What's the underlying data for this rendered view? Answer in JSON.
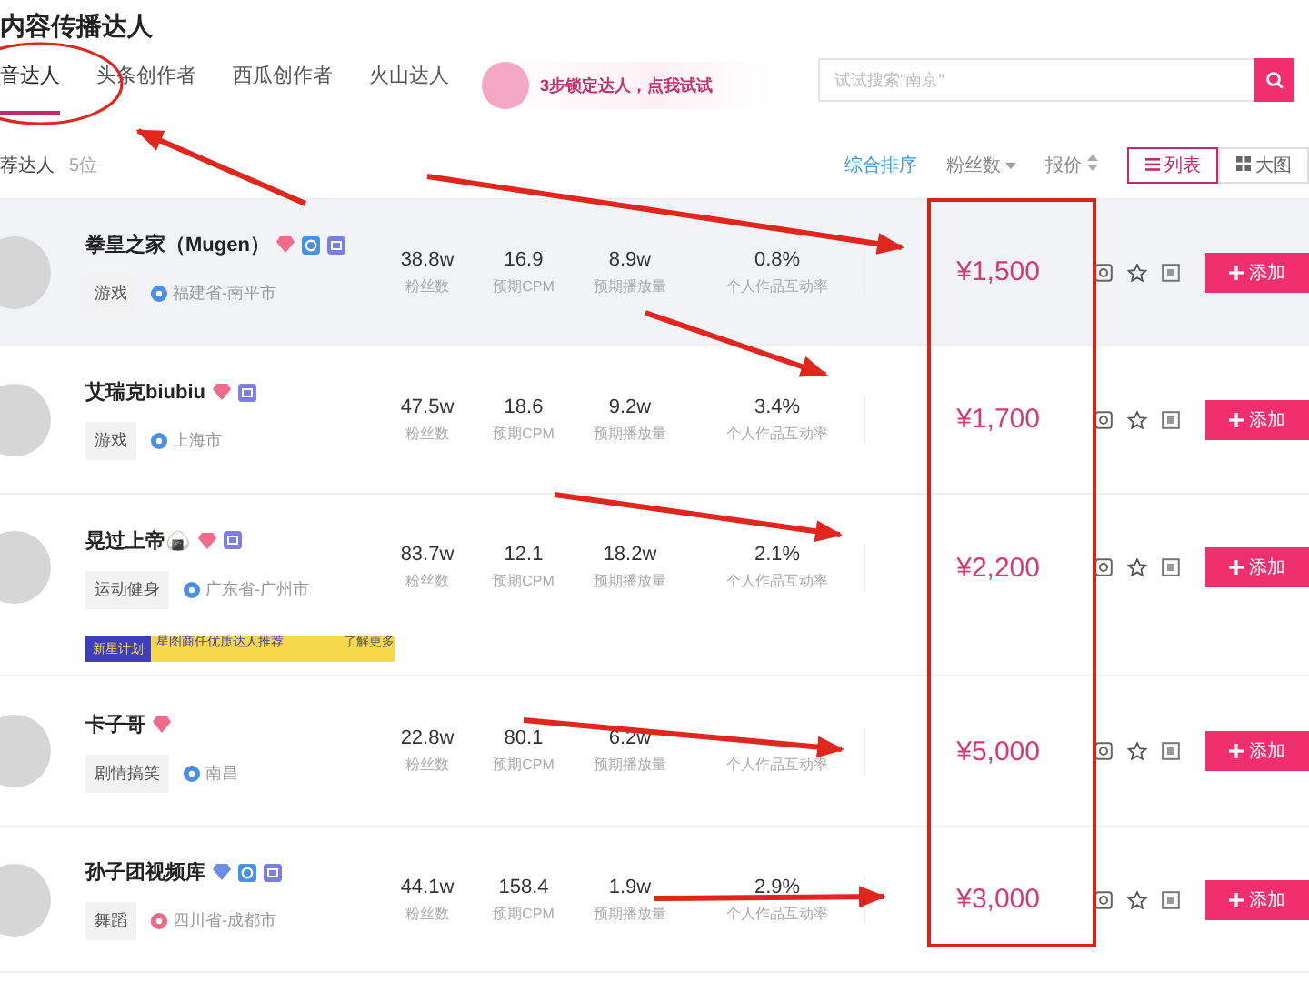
{
  "page_title": "内容传播达人",
  "tabs": [
    {
      "label": "音达人",
      "selected": true
    },
    {
      "label": "头条创作者",
      "selected": false
    },
    {
      "label": "西瓜创作者",
      "selected": false
    },
    {
      "label": "火山达人",
      "selected": false
    }
  ],
  "promo": {
    "text": "3步锁定达人，点我试试"
  },
  "search": {
    "placeholder": "试试搜索\"南京\""
  },
  "list_header": {
    "title": "荐达人",
    "count": "5位"
  },
  "sort_options": [
    {
      "label": "综合排序",
      "selected": true,
      "kind": "plain"
    },
    {
      "label": "粉丝数",
      "selected": false,
      "kind": "dropdown"
    },
    {
      "label": "报价",
      "selected": false,
      "kind": "sort"
    }
  ],
  "view_toggle": [
    {
      "label": "列表",
      "selected": true,
      "kind": "list"
    },
    {
      "label": "大图",
      "selected": false,
      "kind": "grid"
    }
  ],
  "rows": [
    {
      "name": "拳皇之家（Mugen）",
      "highlighted": true,
      "badges": [
        {
          "kind": "gem",
          "color": "#f06a8a"
        },
        {
          "kind": "ring",
          "color": "#4a90e2"
        },
        {
          "kind": "shop",
          "color": "#7b7fe0"
        }
      ],
      "tag": "游戏",
      "location": {
        "text": "福建省-南平市",
        "color": "#4a90e2"
      },
      "fans": "38.8w",
      "fans_label": "粉丝数",
      "cpm": "16.9",
      "cpm_label": "预期CPM",
      "plays": "8.9w",
      "plays_label": "预期播放量",
      "rate": "0.8%",
      "rate_label": "个人作品互动率",
      "price": "¥1,500",
      "add": "添加"
    },
    {
      "name": "艾瑞克biubiu",
      "highlighted": false,
      "badges": [
        {
          "kind": "gem",
          "color": "#f06a8a"
        },
        {
          "kind": "shop",
          "color": "#7b7fe0"
        }
      ],
      "tag": "游戏",
      "location": {
        "text": "上海市",
        "color": "#4a90e2"
      },
      "fans": "47.5w",
      "fans_label": "粉丝数",
      "cpm": "18.6",
      "cpm_label": "预期CPM",
      "plays": "9.2w",
      "plays_label": "预期播放量",
      "rate": "3.4%",
      "rate_label": "个人作品互动率",
      "price": "¥1,700",
      "add": "添加"
    },
    {
      "name": "晃过上帝🍙",
      "highlighted": false,
      "badges": [
        {
          "kind": "gem",
          "color": "#f06a8a"
        },
        {
          "kind": "shop",
          "color": "#7b7fe0"
        }
      ],
      "tag": "运动健身",
      "location": {
        "text": "广东省-广州市",
        "color": "#4a90e2"
      },
      "fans": "83.7w",
      "fans_label": "粉丝数",
      "cpm": "12.1",
      "cpm_label": "预期CPM",
      "plays": "18.2w",
      "plays_label": "预期播放量",
      "rate": "2.1%",
      "rate_label": "个人作品互动率",
      "price": "¥2,200",
      "add": "添加",
      "banner": {
        "label": "新星计划",
        "text": "星图商任优质达人推荐",
        "link": "了解更多"
      }
    },
    {
      "name": "卡子哥",
      "highlighted": false,
      "badges": [
        {
          "kind": "gem",
          "color": "#f06a8a"
        }
      ],
      "tag": "剧情搞笑",
      "location": {
        "text": "南昌",
        "color": "#4a90e2"
      },
      "fans": "22.8w",
      "fans_label": "粉丝数",
      "cpm": "80.1",
      "cpm_label": "预期CPM",
      "plays": "6.2w",
      "plays_label": "预期播放量",
      "rate_label": "个人作品互动率",
      "price": "¥5,000",
      "add": "添加"
    },
    {
      "name": "孙子团视频库",
      "highlighted": false,
      "badges": [
        {
          "kind": "gem",
          "color": "#6a8ee8"
        },
        {
          "kind": "ring",
          "color": "#4a90e2"
        },
        {
          "kind": "shop",
          "color": "#7b7fe0"
        }
      ],
      "tag": "舞蹈",
      "location": {
        "text": "四川省-成都市",
        "color": "#e86a8a"
      },
      "fans": "44.1w",
      "fans_label": "粉丝数",
      "cpm": "158.4",
      "cpm_label": "预期CPM",
      "plays": "1.9w",
      "plays_label": "预期播放量",
      "rate": "2.9%",
      "rate_label": "个人作品互动率",
      "price": "¥3,000",
      "add": "添加"
    }
  ]
}
